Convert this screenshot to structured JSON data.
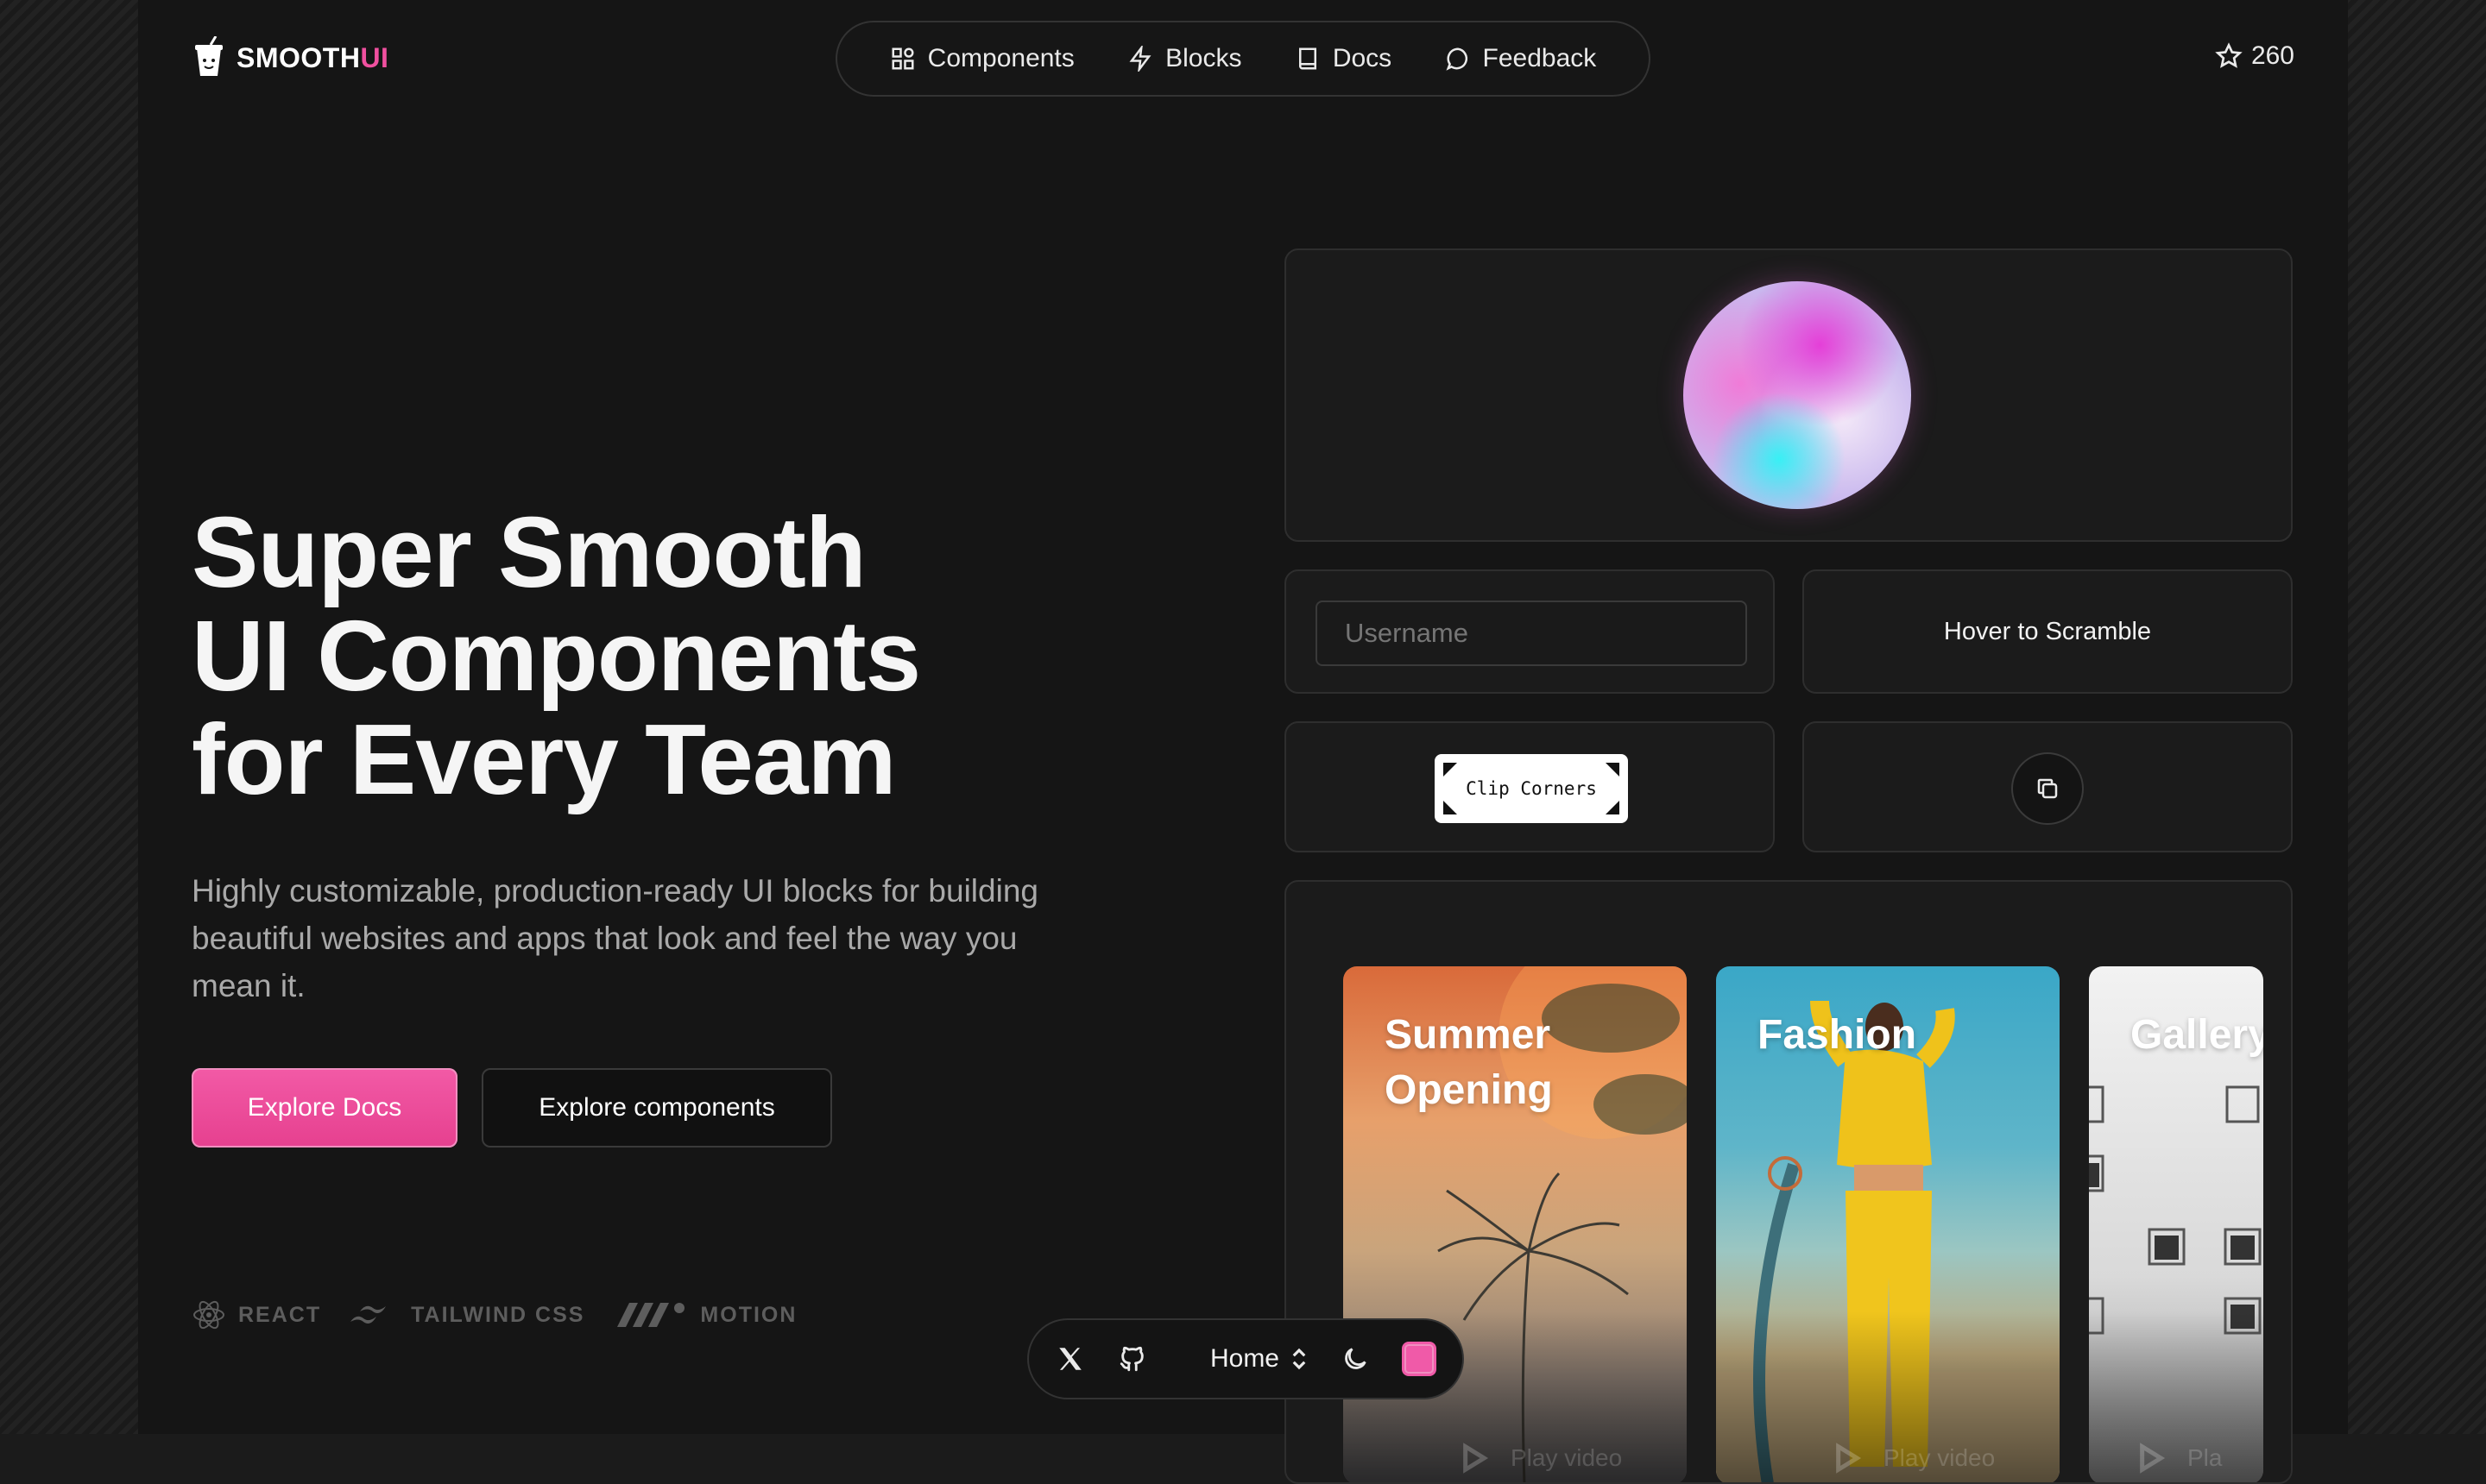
{
  "brand": {
    "name_primary": "SMOOTH",
    "name_accent": "UI",
    "icon": "cup-icon"
  },
  "nav": {
    "items": [
      {
        "label": "Components",
        "icon": "grid-icon"
      },
      {
        "label": "Blocks",
        "icon": "bolt-icon"
      },
      {
        "label": "Docs",
        "icon": "book-icon"
      },
      {
        "label": "Feedback",
        "icon": "chat-bubble-icon"
      }
    ]
  },
  "github_stars": {
    "count": "260",
    "icon": "star-icon"
  },
  "hero": {
    "headline_lines": [
      "Super Smooth",
      "UI Components",
      "for Every Team"
    ],
    "subtext": "Highly customizable, production-ready UI blocks for building beautiful websites and apps that look and feel the way you mean it.",
    "primary_cta": "Explore Docs",
    "secondary_cta": "Explore components"
  },
  "tech_stack": [
    {
      "label": "REACT",
      "icon": "react-icon"
    },
    {
      "label": "TAILWIND CSS",
      "icon": "tailwind-icon"
    },
    {
      "label": "MOTION",
      "icon": "motion-icon"
    }
  ],
  "showcase": {
    "username_placeholder": "Username",
    "scramble_label": "Hover to Scramble",
    "clip_corners_label": "Clip Corners",
    "copy_icon": "copy-icon",
    "video_cards": [
      {
        "title_line1": "Summer",
        "title_line2": "Opening",
        "play_label": "Play video"
      },
      {
        "title_line1": "Fashion",
        "title_line2": "",
        "play_label": "Play video"
      },
      {
        "title_line1": "Gallery",
        "title_line2": "",
        "play_label": "Pla"
      }
    ]
  },
  "dock": {
    "x_icon": "x-logo-icon",
    "github_icon": "github-icon",
    "page_select": "Home",
    "theme_icon": "moon-icon",
    "accent_color": "#f05aa8"
  },
  "colors": {
    "accent": "#f0509f",
    "background": "#151515",
    "card_border": "#2e2e2e"
  }
}
